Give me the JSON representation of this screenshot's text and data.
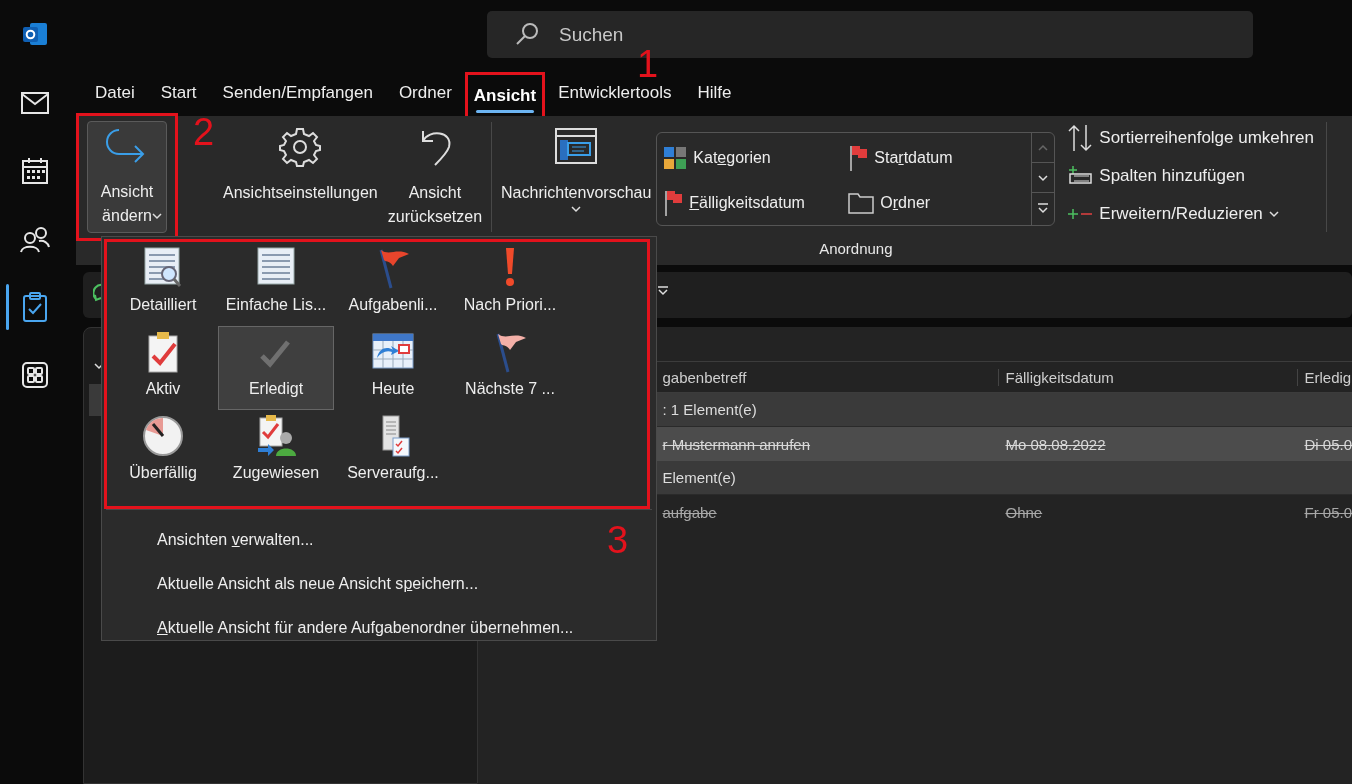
{
  "rail": [
    {
      "kind": "mail",
      "selected": false
    },
    {
      "kind": "calendar",
      "selected": false
    },
    {
      "kind": "people",
      "selected": false
    },
    {
      "kind": "tasks",
      "selected": true
    },
    {
      "kind": "apps",
      "selected": false
    }
  ],
  "search": {
    "placeholder": "Suchen"
  },
  "tabs": [
    {
      "label": "Datei",
      "selected": false
    },
    {
      "label": "Start",
      "selected": false
    },
    {
      "label": "Senden/Empfangen",
      "selected": false
    },
    {
      "label": "Ordner",
      "selected": false
    },
    {
      "label": "Ansicht",
      "selected": true
    },
    {
      "label": "Entwicklertools",
      "selected": false
    },
    {
      "label": "Hilfe",
      "selected": false
    }
  ],
  "ribbon": {
    "big_buttons": [
      {
        "kind": "change",
        "lines": [
          "Ansicht",
          "ändern"
        ],
        "caret": true,
        "selected": true
      },
      {
        "kind": "gear",
        "lines": [
          "Ansichtseinstellungen"
        ],
        "caret": false,
        "selected": false
      },
      {
        "kind": "undo",
        "lines": [
          "Ansicht",
          "zurücksetzen"
        ],
        "caret": false,
        "selected": false
      },
      {
        "kind": "preview",
        "lines": [
          "Nachrichtenvorschau"
        ],
        "caret": true,
        "selected": false
      }
    ],
    "arrangement": {
      "label": "Anordnung",
      "items": [
        {
          "kind": "categories",
          "before": "Kat",
          "key": "e",
          "after": "gorien"
        },
        {
          "kind": "flag",
          "before": "Sta",
          "key": "r",
          "after": "tdatum"
        },
        {
          "kind": "flag",
          "key": "F",
          "after": "älligkeitsdatum"
        },
        {
          "kind": "folder",
          "before": "O",
          "key": "r",
          "after": "dner"
        }
      ]
    },
    "side_buttons": [
      {
        "kind": "sort",
        "label": "Sortierreihenfolge umkehren",
        "caret": false
      },
      {
        "kind": "columns",
        "label": "Spalten hinzufügen",
        "caret": false
      },
      {
        "kind": "expand",
        "label": "Erweitern/Reduzieren",
        "caret": true
      }
    ]
  },
  "view_menu": {
    "gallery": [
      {
        "kind": "detailed",
        "label": "Detailliert",
        "selected": false
      },
      {
        "kind": "list",
        "label": "Einfache Lis...",
        "selected": false
      },
      {
        "kind": "flag",
        "label": "Aufgabenli...",
        "selected": false
      },
      {
        "kind": "priority",
        "label": "Nach Priori...",
        "selected": false
      },
      {
        "kind": "active",
        "label": "Aktiv",
        "selected": false
      },
      {
        "kind": "done",
        "label": "Erledigt",
        "selected": true
      },
      {
        "kind": "today",
        "label": "Heute",
        "selected": false
      },
      {
        "kind": "flag-light",
        "label": "Nächste 7 ...",
        "selected": false
      },
      {
        "kind": "overdue",
        "label": "Überfällig",
        "selected": false
      },
      {
        "kind": "assigned",
        "label": "Zugewiesen",
        "selected": false
      },
      {
        "kind": "server",
        "label": "Serveraufg...",
        "selected": false
      }
    ],
    "commands": [
      {
        "before": "Ansichten ",
        "key": "v",
        "after": "erwalten..."
      },
      {
        "before": "Aktuelle Ansicht als neue Ansicht s",
        "key": "p",
        "after": "eichern..."
      },
      {
        "key": "A",
        "after": "ktuelle Ansicht für andere Aufgabenordner übernehmen..."
      }
    ]
  },
  "table": {
    "columns": [
      "gabenbetreff",
      "Fälligkeitsdatum",
      "Erledig"
    ],
    "rows": [
      {
        "kind": "group",
        "text": ": 1 Element(e)"
      },
      {
        "kind": "task",
        "selected": true,
        "cells": [
          "r Mustermann anrufen",
          "Mo 08.08.2022",
          "Di 05.0"
        ]
      },
      {
        "kind": "group",
        "text": "Element(e)"
      },
      {
        "kind": "task",
        "selected": false,
        "cells": [
          "aufgabe",
          "Ohne",
          "Fr 05.0"
        ]
      }
    ]
  },
  "annotations": [
    {
      "label": "1"
    },
    {
      "label": "2"
    },
    {
      "label": "3"
    }
  ]
}
